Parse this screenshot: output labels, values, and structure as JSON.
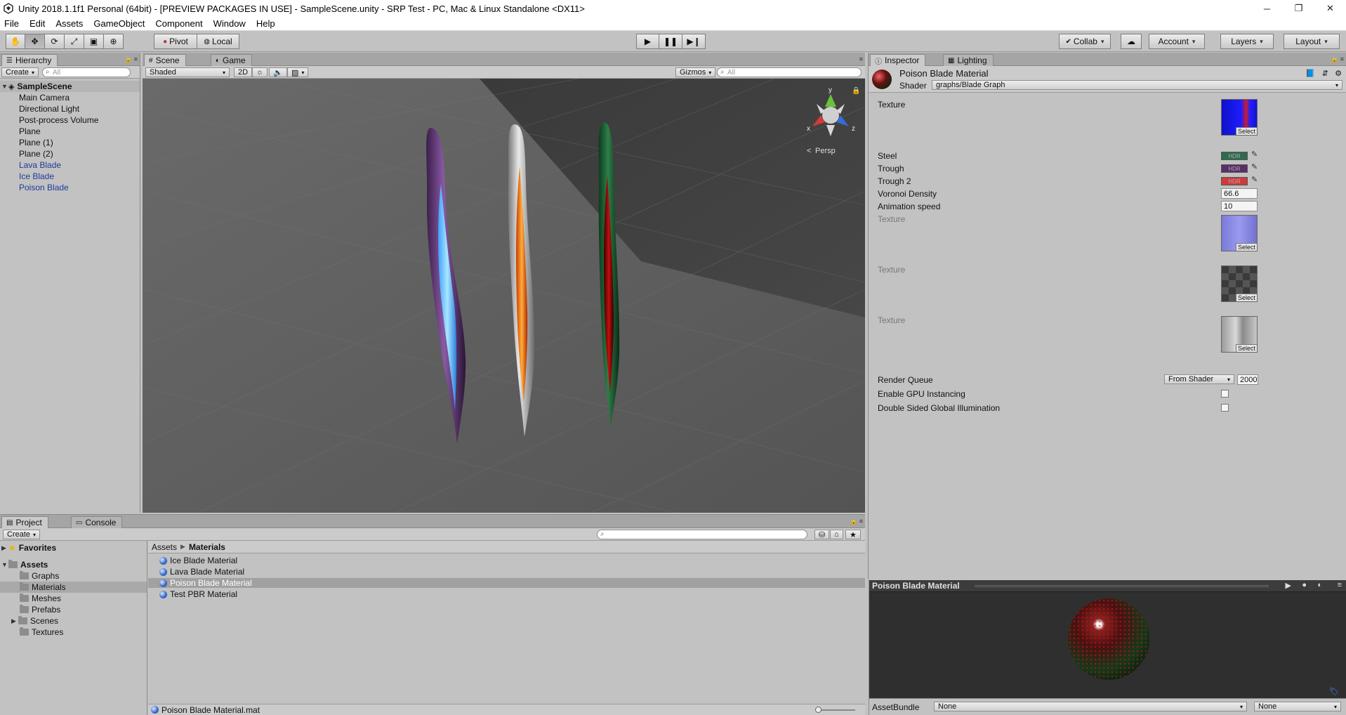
{
  "window": {
    "title": "Unity 2018.1.1f1 Personal (64bit) - [PREVIEW PACKAGES IN USE] - SampleScene.unity - SRP Test - PC, Mac & Linux Standalone <DX11>",
    "minimize": "─",
    "maximize": "❐",
    "close": "✕"
  },
  "menu": [
    "File",
    "Edit",
    "Assets",
    "GameObject",
    "Component",
    "Window",
    "Help"
  ],
  "toolbar": {
    "pivot": "Pivot",
    "local": "Local",
    "collab": "Collab",
    "account": "Account",
    "layers": "Layers",
    "layout": "Layout"
  },
  "hierarchy": {
    "tab": "Hierarchy",
    "create": "Create",
    "search_placeholder": "All",
    "scene": "SampleScene",
    "items": [
      {
        "label": "Main Camera",
        "prefab": false
      },
      {
        "label": "Directional Light",
        "prefab": false
      },
      {
        "label": "Post-process Volume",
        "prefab": false
      },
      {
        "label": "Plane",
        "prefab": false
      },
      {
        "label": "Plane (1)",
        "prefab": false
      },
      {
        "label": "Plane (2)",
        "prefab": false
      },
      {
        "label": "Lava Blade",
        "prefab": true
      },
      {
        "label": "Ice Blade",
        "prefab": true
      },
      {
        "label": "Poison Blade",
        "prefab": true
      }
    ]
  },
  "scene_view": {
    "tab_scene": "Scene",
    "tab_game": "Game",
    "shading": "Shaded",
    "mode_2d": "2D",
    "gizmos": "Gizmos",
    "search_placeholder": "All",
    "gizmo_persp": "Persp",
    "axis_y": "y",
    "axis_x": "x",
    "axis_z": "z"
  },
  "inspector": {
    "tab_inspector": "Inspector",
    "tab_lighting": "Lighting",
    "material_name": "Poison Blade Material",
    "shader_label": "Shader",
    "shader_value": "graphs/Blade Graph",
    "props": {
      "texture1": "Texture",
      "steel": "Steel",
      "trough": "Trough",
      "trough2": "Trough 2",
      "voronoi": "Voronoi Density",
      "voronoi_value": "66.6",
      "anim": "Animation speed",
      "anim_value": "10",
      "texture2": "Texture",
      "texture3": "Texture",
      "texture4": "Texture",
      "hdr": "HDR",
      "select": "Select",
      "render_queue": "Render Queue",
      "render_queue_mode": "From Shader",
      "render_queue_value": "2000",
      "gpu_instancing": "Enable GPU Instancing",
      "double_sided": "Double Sided Global Illumination"
    },
    "colors": {
      "steel": "#2e6b4e",
      "trough": "#5a2e68",
      "trough2": "#d03a3a"
    },
    "preview_title": "Poison Blade Material",
    "assetbundle_label": "AssetBundle",
    "assetbundle_value": "None",
    "assetbundle_variant": "None"
  },
  "project": {
    "tab_project": "Project",
    "tab_console": "Console",
    "create": "Create",
    "favorites": "Favorites",
    "assets": "Assets",
    "folders": [
      "Graphs",
      "Materials",
      "Meshes",
      "Prefabs",
      "Scenes",
      "Textures"
    ],
    "breadcrumb_root": "Assets",
    "breadcrumb_current": "Materials",
    "files": [
      "Ice Blade Material",
      "Lava Blade Material",
      "Poison Blade Material",
      "Test PBR Material"
    ],
    "selected_file_path": "Poison Blade Material.mat"
  }
}
